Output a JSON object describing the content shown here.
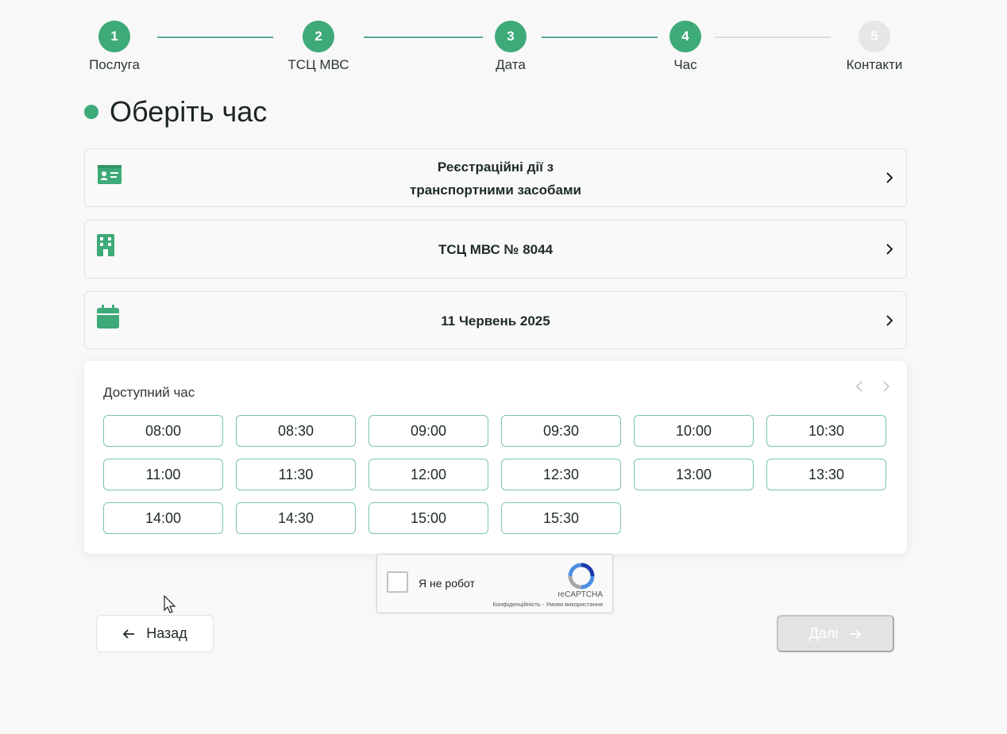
{
  "stepper": {
    "steps": [
      {
        "number": "1",
        "label": "Послуга",
        "state": "done"
      },
      {
        "number": "2",
        "label": "ТСЦ МВС",
        "state": "done"
      },
      {
        "number": "3",
        "label": "Дата",
        "state": "done"
      },
      {
        "number": "4",
        "label": "Час",
        "state": "current"
      },
      {
        "number": "5",
        "label": "Контакти",
        "state": "inactive"
      }
    ]
  },
  "page": {
    "title": "Оберіть час"
  },
  "summary": {
    "service": {
      "line1": "Реєстраційні дії з",
      "line2": "транспортними засобами",
      "icon": "id-card-icon"
    },
    "center": {
      "label": "ТСЦ МВС № 8044",
      "icon": "building-icon"
    },
    "date": {
      "label": "11 Червень 2025",
      "icon": "calendar-icon"
    }
  },
  "timepanel": {
    "title": "Доступний час",
    "slots": [
      "08:00",
      "08:30",
      "09:00",
      "09:30",
      "10:00",
      "10:30",
      "11:00",
      "11:30",
      "12:00",
      "12:30",
      "13:00",
      "13:30",
      "14:00",
      "14:30",
      "15:00",
      "15:30"
    ]
  },
  "captcha": {
    "label": "Я не робот",
    "brand": "reCAPTCHA",
    "terms": "Конфіденційність - Умови використання"
  },
  "nav": {
    "back_label": "Назад",
    "next_label": "Далі"
  },
  "colors": {
    "accent": "#3daa78",
    "slot_border": "#7bc2b2",
    "disabled": "#e2e4e4"
  }
}
